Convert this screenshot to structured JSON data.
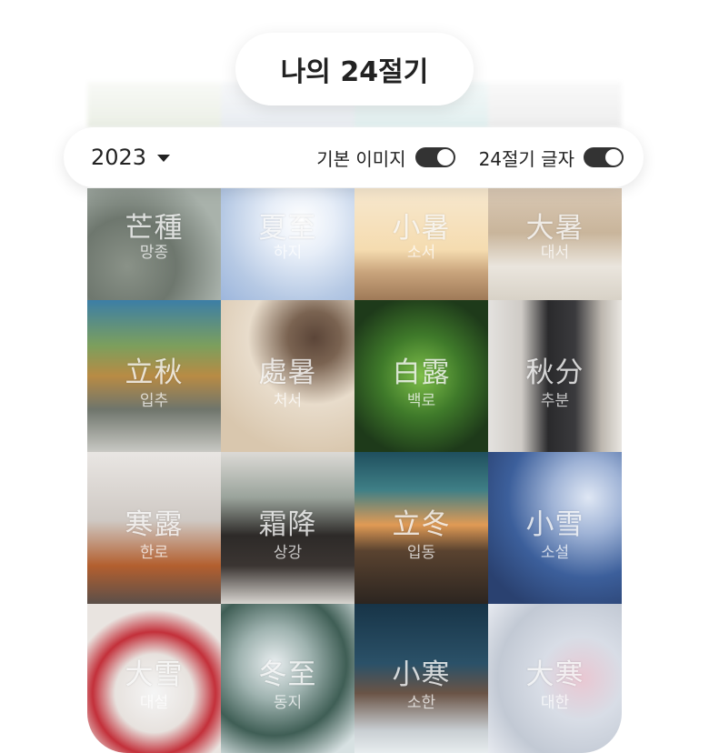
{
  "title": "나의 24절기",
  "filter": {
    "year": "2023",
    "toggle_default_image": "기본 이미지",
    "toggle_terms_text": "24절기 글자"
  },
  "terms": [
    {
      "hanja": "芒種",
      "hangul": "망종"
    },
    {
      "hanja": "夏至",
      "hangul": "하지"
    },
    {
      "hanja": "小暑",
      "hangul": "소서"
    },
    {
      "hanja": "大暑",
      "hangul": "대서"
    },
    {
      "hanja": "立秋",
      "hangul": "입추"
    },
    {
      "hanja": "處暑",
      "hangul": "처서"
    },
    {
      "hanja": "白露",
      "hangul": "백로"
    },
    {
      "hanja": "秋分",
      "hangul": "추분"
    },
    {
      "hanja": "寒露",
      "hangul": "한로"
    },
    {
      "hanja": "霜降",
      "hangul": "상강"
    },
    {
      "hanja": "立冬",
      "hangul": "입동"
    },
    {
      "hanja": "小雪",
      "hangul": "소설"
    },
    {
      "hanja": "大雪",
      "hangul": "대설"
    },
    {
      "hanja": "冬至",
      "hangul": "동지"
    },
    {
      "hanja": "小寒",
      "hangul": "소한"
    },
    {
      "hanja": "大寒",
      "hangul": "대한"
    }
  ],
  "colors": {
    "toggle_on": "#333333",
    "card_bg": "#ffffff"
  }
}
